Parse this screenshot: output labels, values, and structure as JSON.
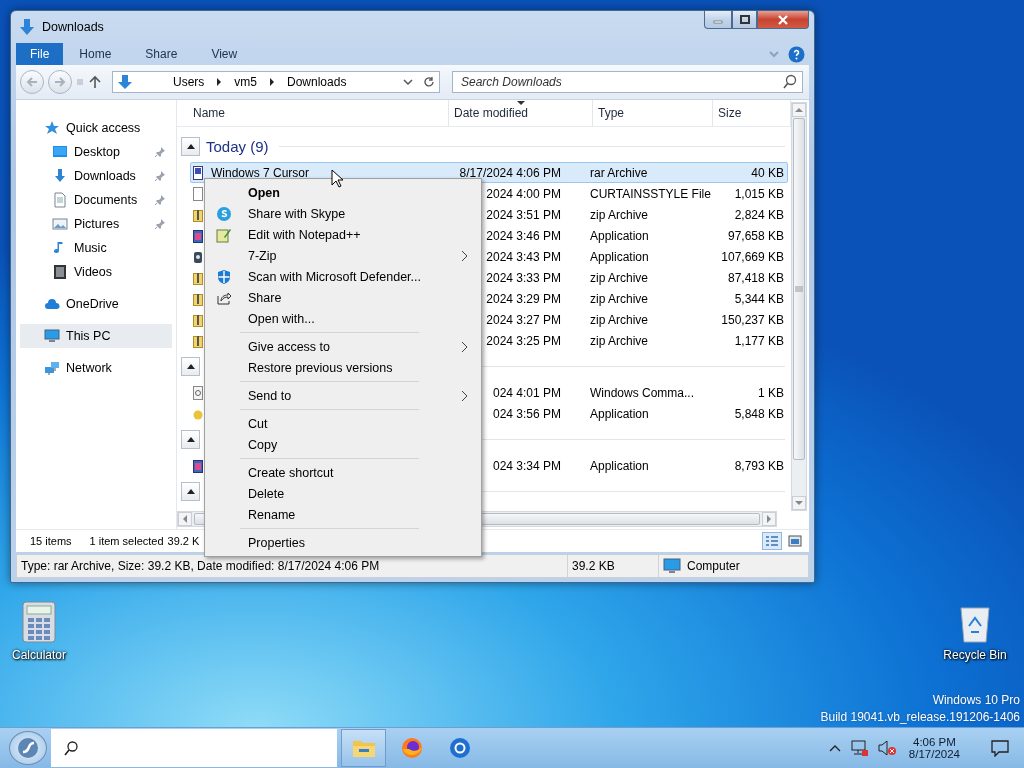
{
  "window": {
    "title": "Downloads"
  },
  "ribbon_tabs": [
    {
      "label": "File",
      "selected": true
    },
    {
      "label": "Home",
      "selected": false
    },
    {
      "label": "Share",
      "selected": false
    },
    {
      "label": "View",
      "selected": false
    }
  ],
  "address_bar": {
    "path": [
      "Users",
      "vm5",
      "Downloads"
    ]
  },
  "search": {
    "placeholder": "Search Downloads"
  },
  "nav_pane": [
    {
      "label": "Quick access",
      "kind": "star",
      "selected": false,
      "children": [
        {
          "label": "Desktop",
          "kind": "desktop",
          "pinned": true,
          "selected": false
        },
        {
          "label": "Downloads",
          "kind": "download",
          "pinned": true,
          "selected": false
        },
        {
          "label": "Documents",
          "kind": "document",
          "pinned": true,
          "selected": false
        },
        {
          "label": "Pictures",
          "kind": "picture",
          "pinned": true,
          "selected": false
        },
        {
          "label": "Music",
          "kind": "music",
          "pinned": false,
          "selected": false
        },
        {
          "label": "Videos",
          "kind": "video",
          "pinned": false,
          "selected": false
        }
      ]
    },
    {
      "label": "OneDrive",
      "kind": "cloud",
      "selected": false
    },
    {
      "label": "This PC",
      "kind": "pc",
      "selected": true
    },
    {
      "label": "Network",
      "kind": "network",
      "selected": false
    }
  ],
  "columns": [
    {
      "label": "Name",
      "sorted": false
    },
    {
      "label": "Date modified",
      "sorted": true
    },
    {
      "label": "Type",
      "sorted": false
    },
    {
      "label": "Size",
      "sorted": false
    }
  ],
  "groups": [
    {
      "title": "Today (9)",
      "expanded": true,
      "rows": [
        {
          "name": "Windows 7 Cursor",
          "kind": "rar",
          "date": "8/17/2024 4:06 PM",
          "type": "rar Archive",
          "size": "40 KB",
          "selected": true
        },
        {
          "kind": "blank",
          "date": "2024 4:00 PM",
          "type": "CURTAINSSTYLE File",
          "size": "1,015 KB",
          "selected": false
        },
        {
          "kind": "zip",
          "date": "2024 3:51 PM",
          "type": "zip Archive",
          "size": "2,824 KB",
          "selected": false
        },
        {
          "kind": "app",
          "date": "2024 3:46 PM",
          "type": "Application",
          "size": "97,658 KB",
          "selected": false
        },
        {
          "kind": "setup",
          "date": "2024 3:43 PM",
          "type": "Application",
          "size": "107,669 KB",
          "selected": false
        },
        {
          "kind": "zip",
          "date": "2024 3:33 PM",
          "type": "zip Archive",
          "size": "87,418 KB",
          "selected": false
        },
        {
          "kind": "zip",
          "date": "2024 3:29 PM",
          "type": "zip Archive",
          "size": "5,344 KB",
          "selected": false
        },
        {
          "kind": "zip",
          "date": "2024 3:27 PM",
          "type": "zip Archive",
          "size": "150,237 KB",
          "selected": false
        },
        {
          "kind": "zip",
          "date": "2024 3:25 PM",
          "type": "zip Archive",
          "size": "1,177 KB",
          "selected": false
        }
      ]
    },
    {
      "expanded": true,
      "rows": [
        {
          "kind": "cmd",
          "date": "024 4:01 PM",
          "type": "Windows Comma...",
          "size": "1 KB",
          "selected": false
        },
        {
          "kind": "round",
          "date": "024 3:56 PM",
          "type": "Application",
          "size": "5,848 KB",
          "selected": false
        }
      ]
    },
    {
      "expanded": true,
      "rows": [
        {
          "kind": "app",
          "date": "024 3:34 PM",
          "type": "Application",
          "size": "8,793 KB",
          "selected": false
        }
      ]
    },
    {
      "expanded": true
    }
  ],
  "details_bar": [
    "15 items",
    "1 item selected",
    "39.2 K"
  ],
  "status_bar": {
    "description": "Type: rar Archive, Size: 39.2 KB, Date modified: 8/17/2024 4:06 PM",
    "size": "39.2 KB",
    "location": "Computer"
  },
  "context_menu": {
    "sections": [
      {
        "items": [
          {
            "label": "Open",
            "kind": "text",
            "default": true,
            "submenu": false
          },
          {
            "label": "Share with Skype",
            "kind": "skype",
            "default": false,
            "submenu": false
          },
          {
            "label": "Edit with Notepad++",
            "kind": "notepad",
            "default": false,
            "submenu": false
          },
          {
            "label": "7-Zip",
            "kind": "text",
            "default": false,
            "submenu": true
          },
          {
            "label": "Scan with Microsoft Defender...",
            "kind": "shield",
            "default": false,
            "submenu": false
          },
          {
            "label": "Share",
            "kind": "share",
            "default": false,
            "submenu": false
          },
          {
            "label": "Open with...",
            "kind": "text",
            "default": false,
            "submenu": false
          }
        ]
      },
      {
        "items": [
          {
            "label": "Give access to",
            "kind": "text",
            "default": false,
            "submenu": true
          },
          {
            "label": "Restore previous versions",
            "kind": "text",
            "default": false,
            "submenu": false
          }
        ]
      },
      {
        "items": [
          {
            "label": "Send to",
            "kind": "text",
            "default": false,
            "submenu": true
          }
        ]
      },
      {
        "items": [
          {
            "label": "Cut",
            "kind": "text",
            "default": false,
            "submenu": false
          },
          {
            "label": "Copy",
            "kind": "text",
            "default": false,
            "submenu": false
          }
        ]
      },
      {
        "items": [
          {
            "label": "Create shortcut",
            "kind": "text",
            "default": false,
            "submenu": false
          },
          {
            "label": "Delete",
            "kind": "text",
            "default": false,
            "submenu": false
          },
          {
            "label": "Rename",
            "kind": "text",
            "default": false,
            "submenu": false
          }
        ]
      },
      {
        "items": [
          {
            "label": "Properties",
            "kind": "text",
            "default": false,
            "submenu": false
          }
        ]
      }
    ]
  },
  "desktop_icons": [
    {
      "label": "Calculator",
      "kind": "calculator"
    },
    {
      "label": "Recycle Bin",
      "kind": "recycle"
    }
  ],
  "os_info": [
    "Windows 10 Pro",
    "Build 19041.vb_release.191206-1406"
  ],
  "taskbar": {
    "apps": [
      {
        "kind": "folder",
        "active": true
      },
      {
        "kind": "firefox",
        "active": false
      },
      {
        "kind": "browser",
        "active": false
      }
    ],
    "time": "4:06 PM",
    "date": "8/17/2024"
  }
}
